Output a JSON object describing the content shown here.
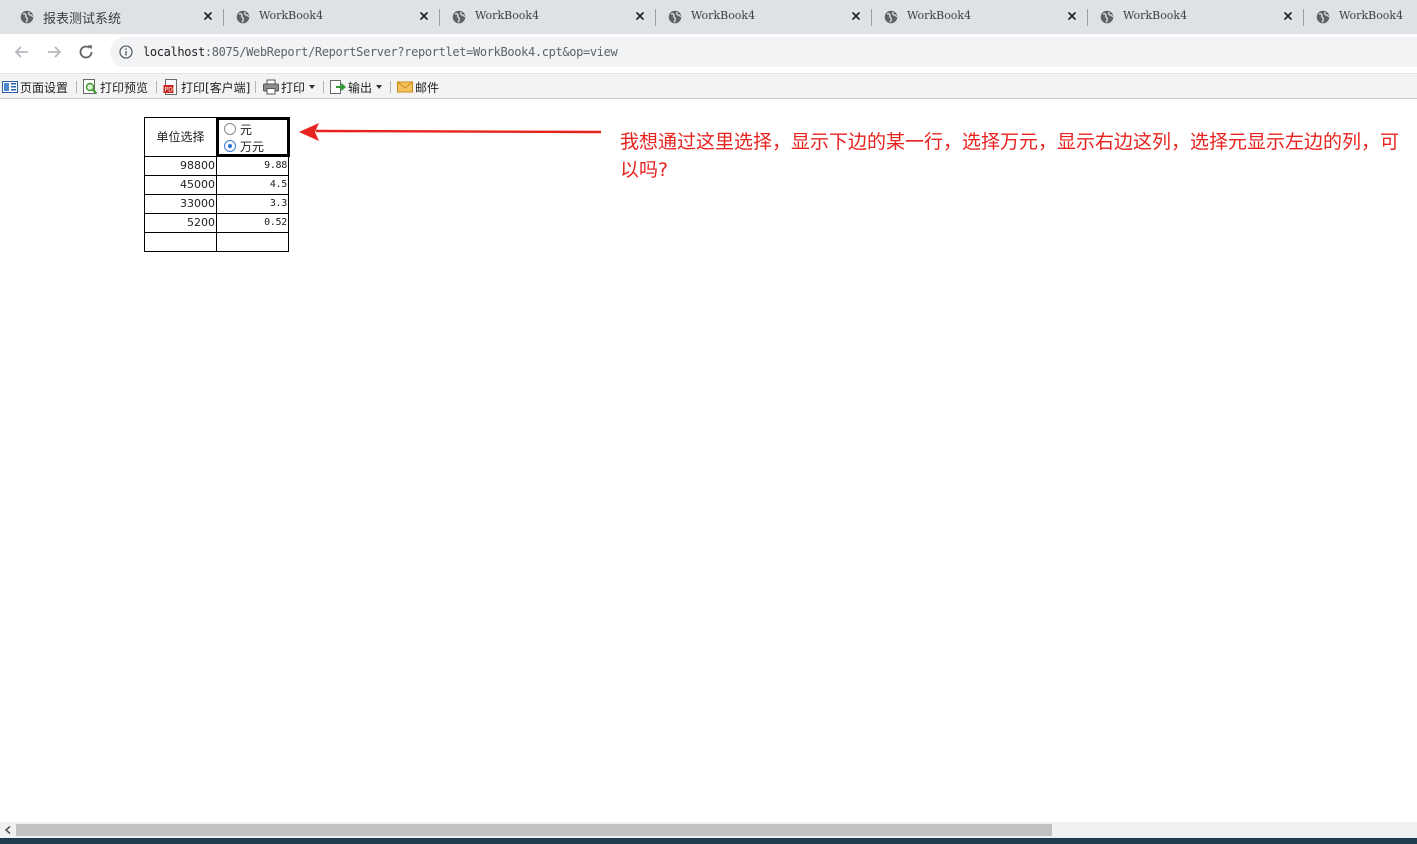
{
  "browser": {
    "tabs": [
      {
        "title": "报表测试系统",
        "active": true
      },
      {
        "title": "WorkBook4",
        "active": false
      },
      {
        "title": "WorkBook4",
        "active": false
      },
      {
        "title": "WorkBook4",
        "active": false
      },
      {
        "title": "WorkBook4",
        "active": false
      },
      {
        "title": "WorkBook4",
        "active": false
      },
      {
        "title": "WorkBook4",
        "active": false
      }
    ],
    "url_host": "localhost",
    "url_rest": ":8075/WebReport/ReportServer?reportlet=WorkBook4.cpt&op=view"
  },
  "toolbar": {
    "page_setup": "页面设置",
    "print_preview": "打印预览",
    "print_client": "打印[客户端]",
    "print": "打印",
    "export": "输出",
    "mail": "邮件"
  },
  "report": {
    "unit_label": "单位选择",
    "radio_options": [
      {
        "label": "元",
        "checked": false
      },
      {
        "label": "万元",
        "checked": true
      }
    ],
    "rows": [
      {
        "yuan": "98800",
        "wanyuan": "9.88"
      },
      {
        "yuan": "45000",
        "wanyuan": "4.5"
      },
      {
        "yuan": "33000",
        "wanyuan": "3.3"
      },
      {
        "yuan": "5200",
        "wanyuan": "0.52"
      },
      {
        "yuan": "",
        "wanyuan": ""
      }
    ]
  },
  "annotation": {
    "text": "我想通过这里选择，显示下边的某一行，选择万元，显示右边这列，选择元显示左边的列，可以吗?",
    "color": "#e8231f"
  },
  "colors": {
    "tabstrip": "#dee1e6",
    "omnibox": "#f1f3f4",
    "radio_selected": "#2a6bd0"
  }
}
